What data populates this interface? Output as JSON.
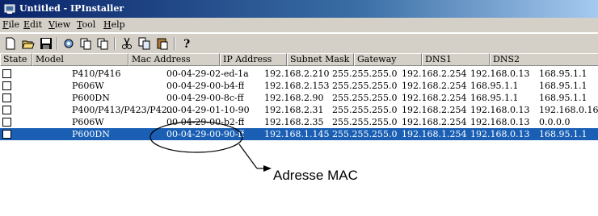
{
  "window": {
    "title": "Untitled - IPInstaller"
  },
  "menu": [
    "File",
    "Edit",
    "View",
    "Tool",
    "Help"
  ],
  "toolbar": {
    "buttons": [
      "new-icon",
      "open-icon",
      "save-icon",
      "search-icon",
      "copy-icon",
      "paste-icon",
      "cut-icon",
      "copy2-icon",
      "paste2-icon",
      "help-icon"
    ]
  },
  "table": {
    "columns": [
      "State",
      "Model",
      "Mac Address",
      "IP Address",
      "Subnet Mask",
      "Gateway",
      "DNS1",
      "DNS2"
    ],
    "rows": [
      {
        "model": "P410/P416",
        "mac": "00-04-29-02-ed-1a",
        "ip": "192.168.2.210",
        "mask": "255.255.255.0",
        "gw": "192.168.2.254",
        "dns1": "192.168.0.13",
        "dns2": "168.95.1.1",
        "selected": false
      },
      {
        "model": "P606W",
        "mac": "00-04-29-00-b4-ff",
        "ip": "192.168.2.153",
        "mask": "255.255.255.0",
        "gw": "192.168.2.254",
        "dns1": "168.95.1.1",
        "dns2": "168.95.1.1",
        "selected": false
      },
      {
        "model": "P600DN",
        "mac": "00-04-29-00-8c-ff",
        "ip": "192.168.2.90",
        "mask": "255.255.255.0",
        "gw": "192.168.2.254",
        "dns1": "168.95.1.1",
        "dns2": "168.95.1.1",
        "selected": false
      },
      {
        "model": "P400/P413/P423/P42...",
        "mac": "00-04-29-01-10-90",
        "ip": "192.168.2.31",
        "mask": "255.255.255.0",
        "gw": "192.168.2.254",
        "dns1": "192.168.0.13",
        "dns2": "192.168.0.16",
        "selected": false
      },
      {
        "model": "P606W",
        "mac": "00-04-29-00-b2-ff",
        "ip": "192.168.2.35",
        "mask": "255.255.255.0",
        "gw": "192.168.2.254",
        "dns1": "192.168.0.13",
        "dns2": "0.0.0.0",
        "selected": false
      },
      {
        "model": "P600DN",
        "mac": "00-04-29-00-90-ff",
        "ip": "192.168.1.145",
        "mask": "255.255.255.0",
        "gw": "192.168.1.254",
        "dns1": "192.168.0.13",
        "dns2": "168.95.1.1",
        "selected": true
      }
    ]
  },
  "annotation": {
    "label": "Adresse MAC"
  },
  "colors": {
    "selection": "#1a5fb4",
    "titlebar": "#0a246a",
    "chrome": "#d4d0c8"
  }
}
